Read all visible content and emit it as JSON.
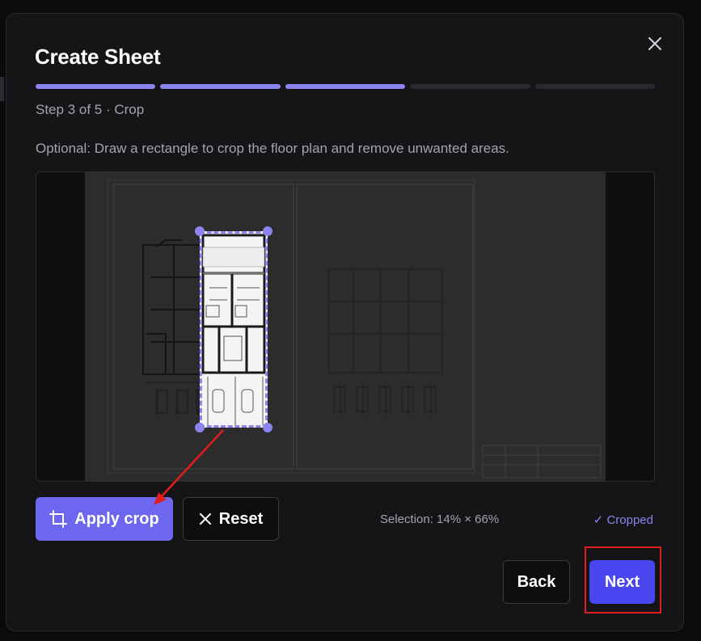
{
  "dialog": {
    "title": "Create Sheet",
    "step_label": "Step 3 of 5 · Crop",
    "description": "Optional: Draw a rectangle to crop the floor plan and remove unwanted areas.",
    "progress": {
      "total_steps": 5,
      "current_step": 3
    }
  },
  "actions": {
    "apply_crop": "Apply crop",
    "reset": "Reset",
    "back": "Back",
    "next": "Next"
  },
  "status": {
    "selection": "Selection: 14% × 66%",
    "cropped": "✓ Cropped"
  },
  "icons": [
    "close-icon",
    "crop-icon",
    "x-icon"
  ],
  "colors": {
    "accent": "#8b83ee",
    "primary_button": "#6d66ee",
    "next_button": "#4a46f0",
    "highlight": "#e11d1d"
  }
}
